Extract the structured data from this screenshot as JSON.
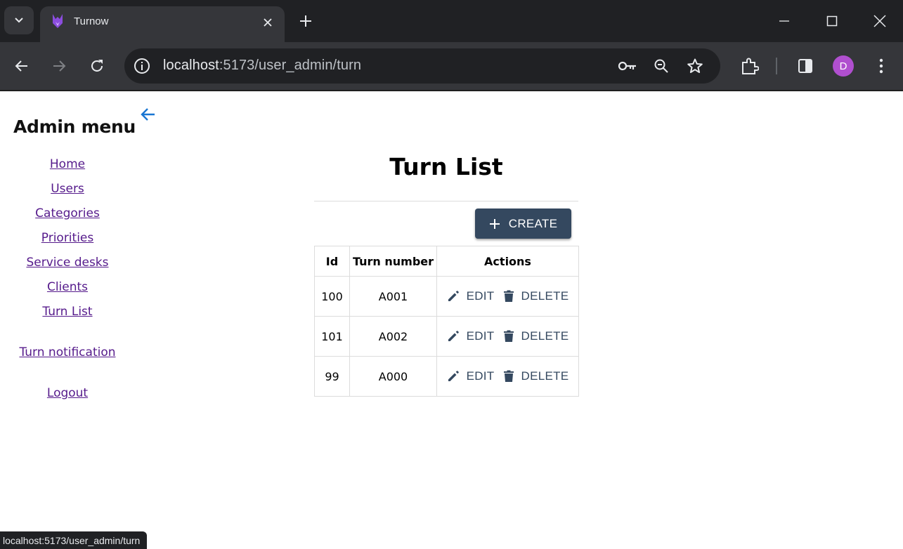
{
  "browser": {
    "tab_title": "Turnow",
    "url_host": "localhost",
    "url_rest": ":5173/user_admin/turn",
    "profile_initial": "D",
    "status_url": "localhost:5173/user_admin/turn"
  },
  "sidebar": {
    "title": "Admin menu",
    "items": [
      {
        "label": "Home"
      },
      {
        "label": "Users"
      },
      {
        "label": "Categories"
      },
      {
        "label": "Priorities"
      },
      {
        "label": "Service desks"
      },
      {
        "label": "Clients"
      },
      {
        "label": "Turn List"
      }
    ],
    "turn_notification": "Turn notification",
    "logout": "Logout"
  },
  "main": {
    "title": "Turn List",
    "create_label": "CREATE",
    "columns": [
      "Id",
      "Turn number",
      "Actions"
    ],
    "rows": [
      {
        "id": "100",
        "turn_number": "A001"
      },
      {
        "id": "101",
        "turn_number": "A002"
      },
      {
        "id": "99",
        "turn_number": "A000"
      }
    ],
    "edit_label": "EDIT",
    "delete_label": "DELETE"
  },
  "colors": {
    "primary": "#34485f",
    "link_visited": "#551a8b",
    "back_arrow": "#1976d2"
  },
  "icons": [
    "chevron-down-icon",
    "close-icon",
    "plus-icon",
    "minimize-icon",
    "maximize-icon",
    "back-icon",
    "forward-icon",
    "reload-icon",
    "site-info-icon",
    "key-icon",
    "zoom-icon",
    "star-icon",
    "extensions-icon",
    "side-panel-icon",
    "more-icon",
    "arrow-left-icon",
    "pencil-icon",
    "trash-icon"
  ]
}
